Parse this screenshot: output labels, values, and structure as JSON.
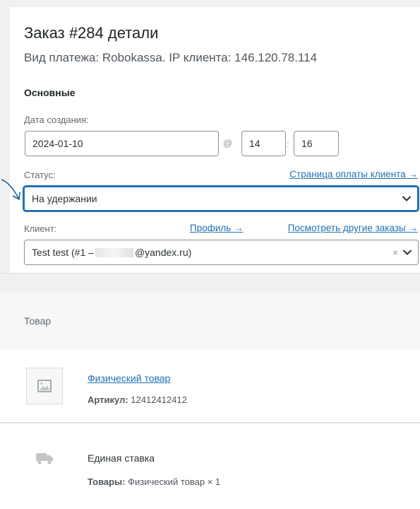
{
  "header": {
    "title": "Заказ #284 детали",
    "subtitle": "Вид платежа: Robokassa. IP клиента: 146.120.78.114"
  },
  "general": {
    "section_title": "Основные",
    "date_label": "Дата создания:",
    "date_value": "2024-01-10",
    "at_sign": "@",
    "hour_value": "14",
    "time_sep": ":",
    "minute_value": "16",
    "status_label": "Статус:",
    "payment_page_link": "Страница оплаты клиента →",
    "status_value": "На удержании",
    "customer_label": "Клиент:",
    "profile_link": "Профиль →",
    "other_orders_link": "Посмотреть другие заказы →",
    "customer_value_prefix": "Test test (#1 –",
    "customer_value_suffix": "@yandex.ru)",
    "clear_symbol": "×"
  },
  "items": {
    "column_header": "Товар",
    "rows": [
      {
        "name": "Физический товар",
        "sku_label": "Артикул:",
        "sku_value": "12412412412"
      }
    ],
    "shipping": {
      "name": "Единая ставка",
      "items_label": "Товары:",
      "items_value": "Физический товар × 1"
    }
  },
  "colors": {
    "accent": "#2271b1",
    "text": "#1d2327",
    "muted": "#646970"
  },
  "icons": [
    "image-placeholder-icon",
    "truck-icon",
    "chevron-down-icon",
    "annotation-arrow-icon"
  ]
}
